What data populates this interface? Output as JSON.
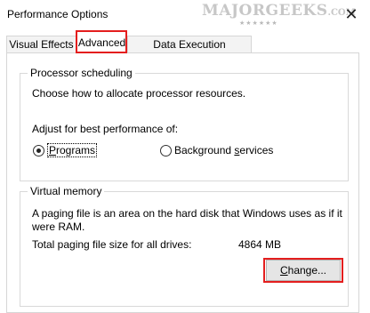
{
  "window": {
    "title": "Performance Options",
    "close_glyph": "✕"
  },
  "watermark": {
    "brand": "MAJORGEEKS",
    "suffix": ".COM",
    "stars": "★★★★★★"
  },
  "tabs": [
    {
      "label": "Visual Effects"
    },
    {
      "label": "Advanced"
    },
    {
      "label": "Data Execution Prevention"
    }
  ],
  "processor": {
    "group_title": "Processor scheduling",
    "description": "Choose how to allocate processor resources.",
    "adjust_label": "Adjust for best performance of:",
    "option_programs": {
      "prefix": "",
      "accel": "P",
      "rest": "rograms"
    },
    "option_background": {
      "prefix": "Background ",
      "accel": "s",
      "rest": "ervices"
    }
  },
  "virtual_memory": {
    "group_title": "Virtual memory",
    "description_line1": "A paging file is an area on the hard disk that Windows uses as if it",
    "description_line2": "were RAM.",
    "total_label": "Total paging file size for all drives:",
    "total_value": "4864 MB",
    "change_button": {
      "accel": "C",
      "rest": "hange..."
    }
  },
  "colors": {
    "highlight": "#e41e1e"
  }
}
